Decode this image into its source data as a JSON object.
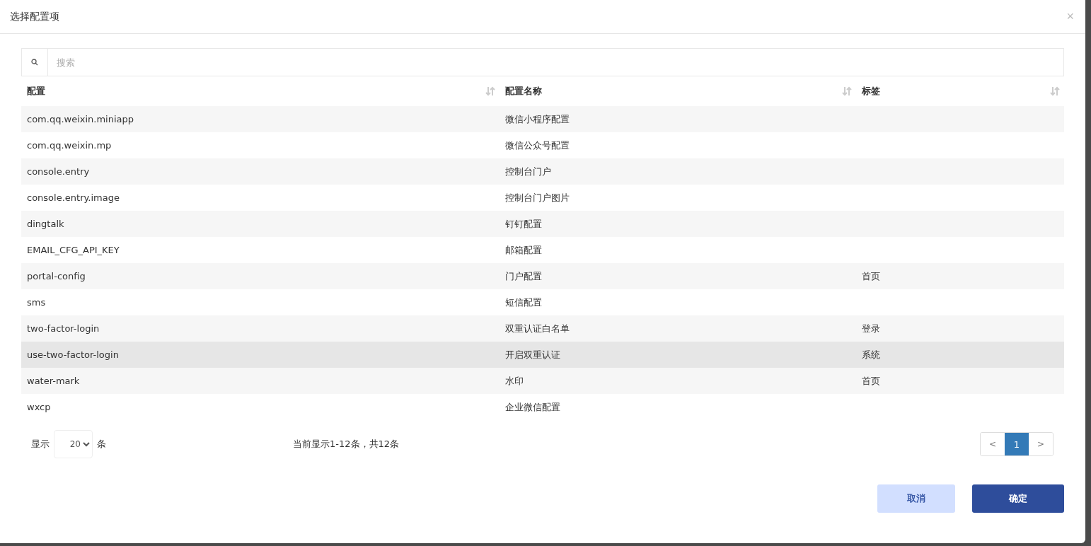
{
  "dialog": {
    "title": "选择配置项",
    "close": "×"
  },
  "search": {
    "placeholder": "搜索"
  },
  "table": {
    "columns": [
      "配置",
      "配置名称",
      "标签"
    ],
    "rows": [
      {
        "cells": [
          "com.qq.weixin.miniapp",
          "微信小程序配置",
          ""
        ],
        "hovered": false
      },
      {
        "cells": [
          "com.qq.weixin.mp",
          "微信公众号配置",
          ""
        ],
        "hovered": false
      },
      {
        "cells": [
          "console.entry",
          "控制台门户",
          ""
        ],
        "hovered": false
      },
      {
        "cells": [
          "console.entry.image",
          "控制台门户图片",
          ""
        ],
        "hovered": false
      },
      {
        "cells": [
          "dingtalk",
          "钉钉配置",
          ""
        ],
        "hovered": false
      },
      {
        "cells": [
          "EMAIL_CFG_API_KEY",
          "邮箱配置",
          ""
        ],
        "hovered": false
      },
      {
        "cells": [
          "portal-config",
          "门户配置",
          "首页"
        ],
        "hovered": false
      },
      {
        "cells": [
          "sms",
          "短信配置",
          ""
        ],
        "hovered": false
      },
      {
        "cells": [
          "two-factor-login",
          "双重认证白名单",
          "登录"
        ],
        "hovered": false
      },
      {
        "cells": [
          "use-two-factor-login",
          "开启双重认证",
          "系统"
        ],
        "hovered": true
      },
      {
        "cells": [
          "water-mark",
          "水印",
          "首页"
        ],
        "hovered": false
      },
      {
        "cells": [
          "wxcp",
          "企业微信配置",
          ""
        ],
        "hovered": false
      }
    ]
  },
  "footer": {
    "show_label": "显示",
    "page_size": "20",
    "unit": "条",
    "summary": "当前显示1-12条，共12条",
    "pages": [
      {
        "label": "<",
        "kind": "prev",
        "selected": false
      },
      {
        "label": "1",
        "kind": "page",
        "selected": true
      },
      {
        "label": ">",
        "kind": "next",
        "selected": false
      }
    ]
  },
  "buttons": [
    {
      "label": "取消",
      "kind": "secondary"
    },
    {
      "label": "确定",
      "kind": "primary"
    }
  ]
}
